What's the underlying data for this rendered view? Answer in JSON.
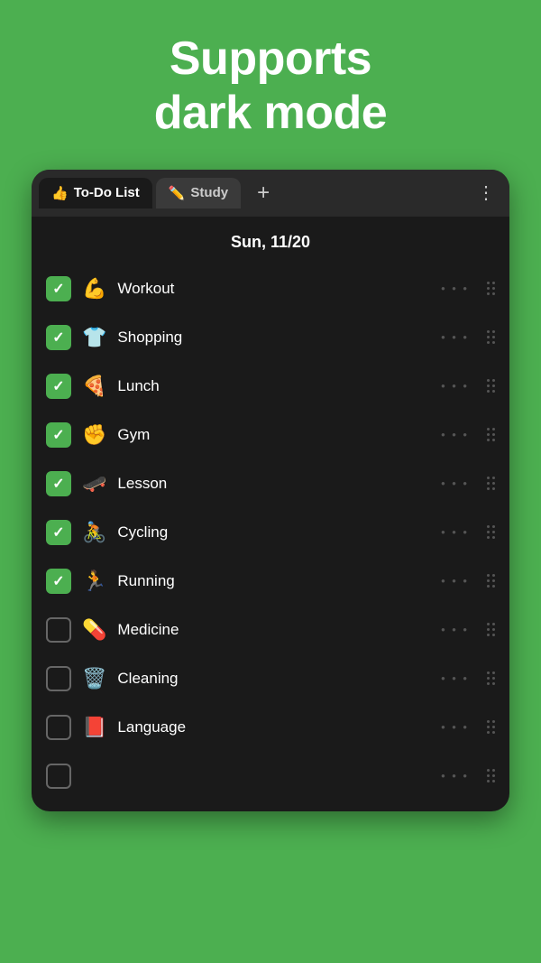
{
  "background_color": "#4caf50",
  "header": {
    "line1": "Supports",
    "line2": "dark mode"
  },
  "tabs": [
    {
      "id": "todo",
      "emoji": "👍",
      "label": "To-Do List",
      "active": true
    },
    {
      "id": "study",
      "emoji": "✏️",
      "label": "Study",
      "active": false
    }
  ],
  "add_button_label": "+",
  "more_button_label": "⋮",
  "date_label": "Sun, 11/20",
  "tasks": [
    {
      "id": 1,
      "emoji": "💪",
      "label": "Workout",
      "checked": true
    },
    {
      "id": 2,
      "emoji": "👕",
      "label": "Shopping",
      "checked": true
    },
    {
      "id": 3,
      "emoji": "🍕",
      "label": "Lunch",
      "checked": true
    },
    {
      "id": 4,
      "emoji": "✊",
      "label": "Gym",
      "checked": true
    },
    {
      "id": 5,
      "emoji": "🛹",
      "label": "Lesson",
      "checked": true
    },
    {
      "id": 6,
      "emoji": "🚴",
      "label": "Cycling",
      "checked": true
    },
    {
      "id": 7,
      "emoji": "🏃",
      "label": "Running",
      "checked": true
    },
    {
      "id": 8,
      "emoji": "💊",
      "label": "Medicine",
      "checked": false
    },
    {
      "id": 9,
      "emoji": "🗑️",
      "label": "Cleaning",
      "checked": false
    },
    {
      "id": 10,
      "emoji": "📕",
      "label": "Language",
      "checked": false
    },
    {
      "id": 11,
      "emoji": "",
      "label": "",
      "checked": false
    }
  ]
}
